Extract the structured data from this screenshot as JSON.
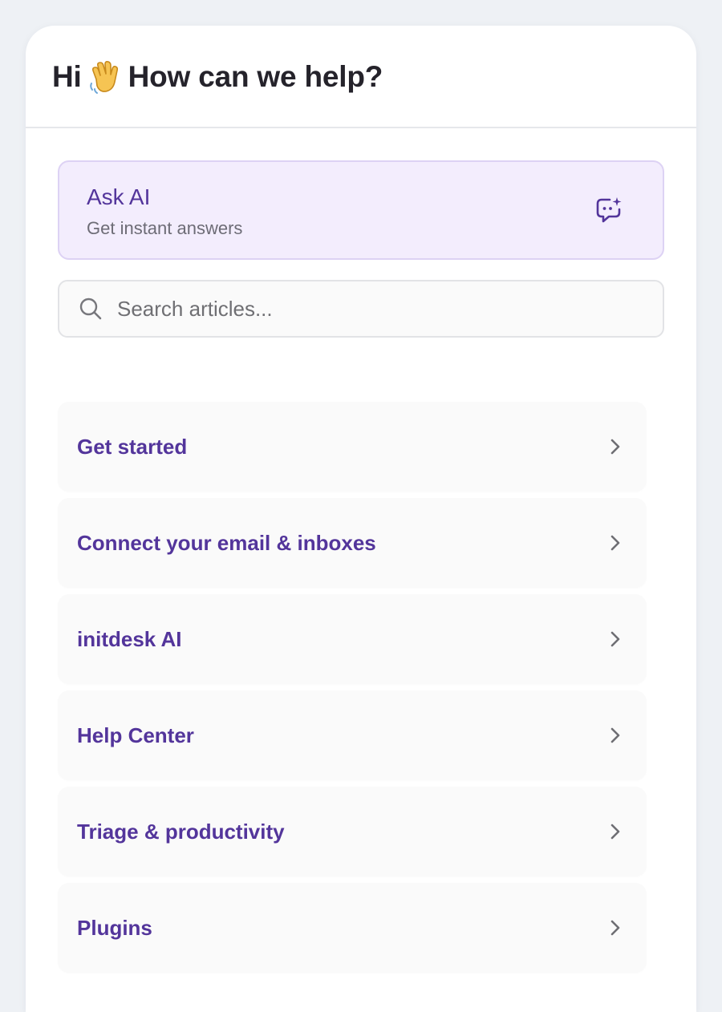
{
  "header": {
    "greeting_prefix": "Hi",
    "greeting_icon": "waving-hand",
    "greeting_suffix": "How can we help?"
  },
  "ask_ai": {
    "title": "Ask AI",
    "subtitle": "Get instant answers",
    "icon": "chat-sparkle-icon"
  },
  "search": {
    "placeholder": "Search articles...",
    "value": ""
  },
  "categories": [
    {
      "label": "Get started"
    },
    {
      "label": "Connect your email & inboxes"
    },
    {
      "label": "initdesk AI"
    },
    {
      "label": "Help Center"
    },
    {
      "label": "Triage & productivity"
    },
    {
      "label": "Plugins"
    }
  ],
  "colors": {
    "accent": "#53359b",
    "ask_ai_background": "#f3edfd",
    "page_background": "#eef1f5"
  }
}
